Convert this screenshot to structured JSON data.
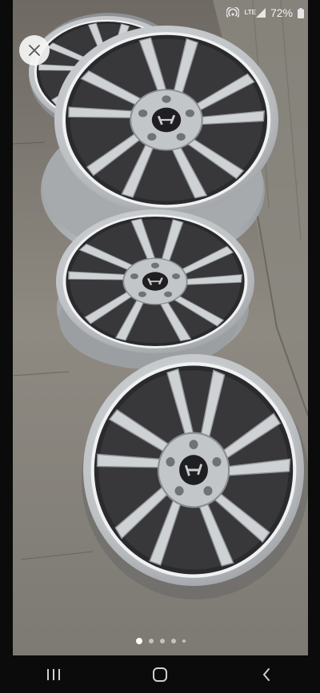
{
  "status_bar": {
    "network_type": "LTE",
    "battery_percent": "72%"
  },
  "viewer": {
    "close_icon": "close-icon",
    "page_indicator": {
      "count": 5,
      "active_index": 0
    },
    "photo_description_colors": {
      "floor": "#8d8a84",
      "wheel_silver": "#c7c9cb"
    }
  },
  "nav_bar": {
    "recents_icon": "recents-icon",
    "home_icon": "home-icon",
    "back_icon": "back-icon"
  }
}
